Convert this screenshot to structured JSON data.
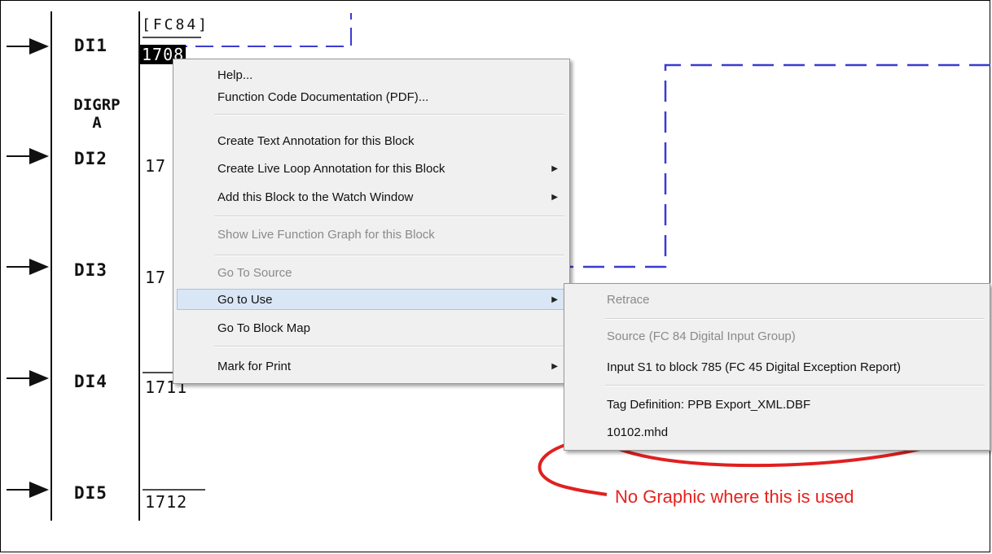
{
  "diagram": {
    "fc_label": "[FC84]",
    "group_label_line1": "DIGRP",
    "group_label_line2": "A",
    "inputs": [
      {
        "label": "DI1",
        "block": "1708"
      },
      {
        "label": "DI2",
        "block": "17"
      },
      {
        "label": "DI3",
        "block": "17"
      },
      {
        "label": "DI4",
        "block": "1711"
      },
      {
        "label": "DI5",
        "block": "1712"
      }
    ]
  },
  "context_menu": {
    "items": [
      {
        "label": "Help...",
        "state": "enabled"
      },
      {
        "label": "Function Code Documentation (PDF)...",
        "state": "enabled"
      },
      {
        "label": "Create Text Annotation for this Block",
        "state": "enabled"
      },
      {
        "label": "Create Live Loop Annotation for this Block",
        "state": "enabled",
        "submenu": true
      },
      {
        "label": "Add this Block to the Watch Window",
        "state": "enabled",
        "submenu": true
      },
      {
        "label": "Show Live Function Graph for this Block",
        "state": "disabled"
      },
      {
        "label": "Go To Source",
        "state": "disabled"
      },
      {
        "label": "Go to Use",
        "state": "highlighted",
        "submenu": true
      },
      {
        "label": "Go To Block Map",
        "state": "enabled"
      },
      {
        "label": "Mark for Print",
        "state": "enabled",
        "submenu": true
      }
    ]
  },
  "submenu": {
    "items": [
      {
        "label": "Retrace",
        "state": "disabled"
      },
      {
        "label": "Source (FC 84 Digital Input Group)",
        "state": "disabled"
      },
      {
        "label": "Input S1 to block 785 (FC 45 Digital Exception Report)",
        "state": "enabled"
      },
      {
        "label": "Tag Definition: PPB Export_XML.DBF",
        "state": "enabled"
      },
      {
        "label": "10102.mhd",
        "state": "enabled"
      }
    ]
  },
  "annotation": {
    "text": "No Graphic where this is used",
    "color": "#e8211d"
  },
  "colors": {
    "dashed_line": "#3b3bd1",
    "menu_background": "#f0f0f0",
    "highlight": "#d9e6f5"
  }
}
